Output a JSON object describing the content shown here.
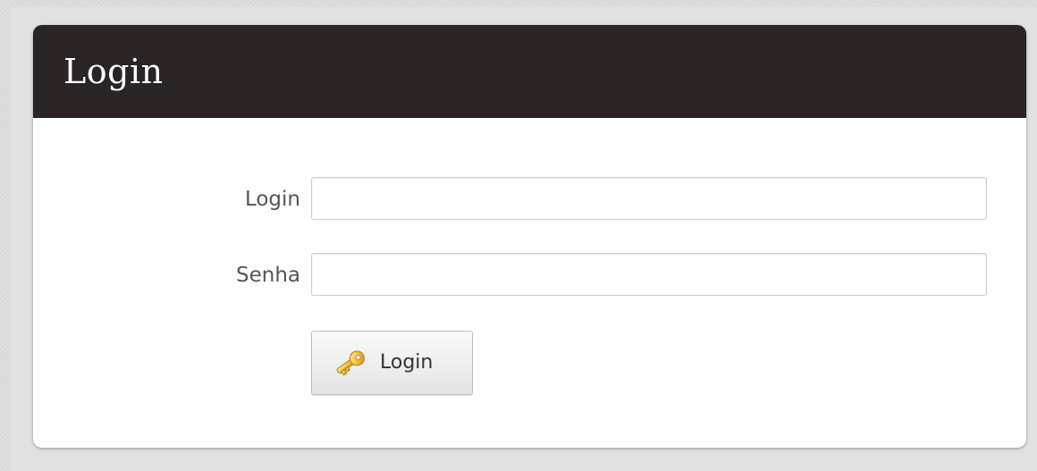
{
  "panel": {
    "title": "Login"
  },
  "form": {
    "login": {
      "label": "Login",
      "value": "",
      "placeholder": ""
    },
    "password": {
      "label": "Senha",
      "value": "",
      "placeholder": ""
    },
    "submit": {
      "label": "Login",
      "icon": "key-icon"
    }
  },
  "colors": {
    "header": "#2a2424",
    "panel": "#ffffff",
    "background": "#dcdcdc",
    "key_icon": "#e8b41f"
  }
}
